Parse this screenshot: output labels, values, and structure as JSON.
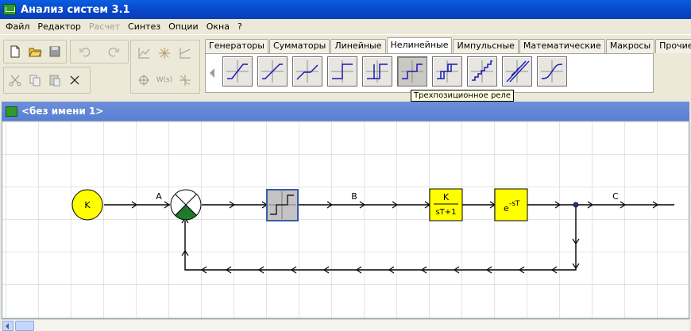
{
  "window": {
    "title": "Анализ систем 3.1",
    "icon": "app-icon"
  },
  "menu": {
    "items": [
      {
        "label": "Файл",
        "enabled": true
      },
      {
        "label": "Редактор",
        "enabled": true
      },
      {
        "label": "Расчет",
        "enabled": false
      },
      {
        "label": "Синтез",
        "enabled": true
      },
      {
        "label": "Опции",
        "enabled": true
      },
      {
        "label": "Окна",
        "enabled": true
      },
      {
        "label": "?",
        "enabled": true
      }
    ]
  },
  "toolbar": {
    "buttons": [
      "new-file-icon",
      "open-folder-icon",
      "save-icon",
      "undo-icon",
      "redo-icon",
      "cut-icon",
      "copy-icon",
      "paste-icon",
      "delete-icon",
      "plot-chart-icon",
      "root-locus-icon",
      "step-response-icon",
      "nyquist-icon",
      "transfer-function-icon",
      "bode-icon"
    ],
    "transfer_label": "W(s)"
  },
  "palette": {
    "tabs": [
      {
        "label": "Генераторы",
        "active": false
      },
      {
        "label": "Сумматоры",
        "active": false
      },
      {
        "label": "Линейные",
        "active": false
      },
      {
        "label": "Нелинейные",
        "active": true
      },
      {
        "label": "Импульсные",
        "active": false
      },
      {
        "label": "Математические",
        "active": false
      },
      {
        "label": "Макросы",
        "active": false
      },
      {
        "label": "Прочие",
        "active": false
      }
    ],
    "tooltip": "Трехпозиционное реле",
    "pressed_index": 5
  },
  "document": {
    "title": "<без имени 1>"
  },
  "diagram": {
    "generator_label": "K",
    "signal_a": "A",
    "signal_b": "B",
    "signal_c": "C",
    "block1_num": "K",
    "block1_den": "sT+1",
    "block2_base": "e",
    "block2_exp": "-sT",
    "generator_color": "#ffff00",
    "block_color": "#ffff00",
    "summer_fill": "#1f7a2e"
  }
}
